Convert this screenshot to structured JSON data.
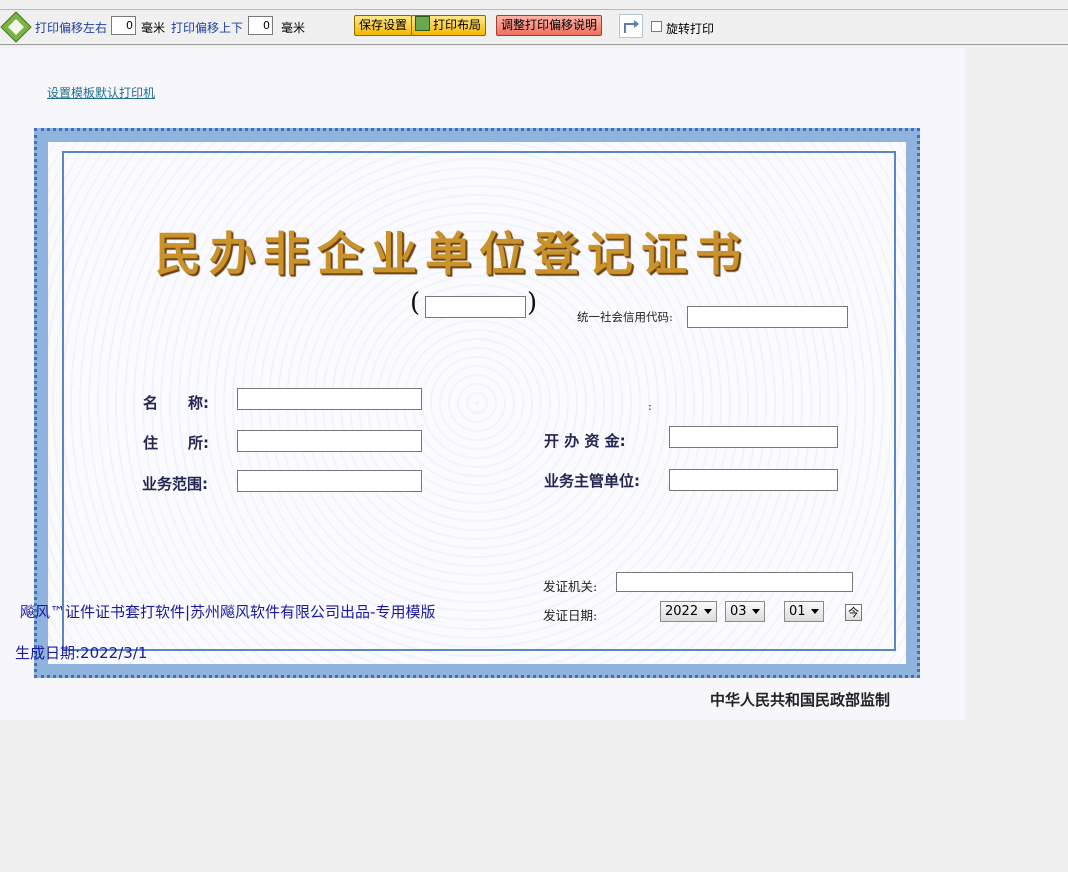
{
  "toolbar": {
    "offset_lr_label": "打印偏移左右",
    "offset_lr_value": "0",
    "offset_lr_unit": "毫米",
    "offset_ud_label": "打印偏移上下",
    "offset_ud_value": "0",
    "offset_ud_unit": "毫米",
    "save_label": "保存设置",
    "layout_label": "打印布局",
    "help_label": "调整打印偏移说明",
    "rotate_label": "旋转打印",
    "rotate_checked": false
  },
  "page": {
    "default_printer_link": "设置模板默认打印机",
    "title": "民办非企业单位登记证书",
    "paren_left": "(",
    "paren_right": ")",
    "credit_code_label": "统一社会信用代码:",
    "name_label": "名　　称:",
    "address_label": "住　　所:",
    "scope_label": "业务范围:",
    "colon_stray": ":",
    "capital_label": "开 办 资 金:",
    "supervisor_label": "业务主管单位:",
    "issuer_label": "发证机关:",
    "issue_date_label": "发证日期:",
    "year": "2022",
    "month": "03",
    "day": "01",
    "today_button": "今",
    "footer_brand": "飚风™证件证书套打软件|苏州飚风软件有限公司出品-专用模版",
    "generated_date": "生成日期:2022/3/1",
    "supervision_note": "中华人民共和国民政部监制"
  },
  "colors": {
    "accent_blue": "#1f3f9f",
    "border_blue": "#8fb3dc",
    "title_gold": "#c9922a",
    "footer_text": "#1a1aa0"
  },
  "icons": {
    "nav": "move-arrows-icon",
    "rotate": "rotate-icon",
    "save": "save-icon",
    "layout": "layout-icon"
  }
}
